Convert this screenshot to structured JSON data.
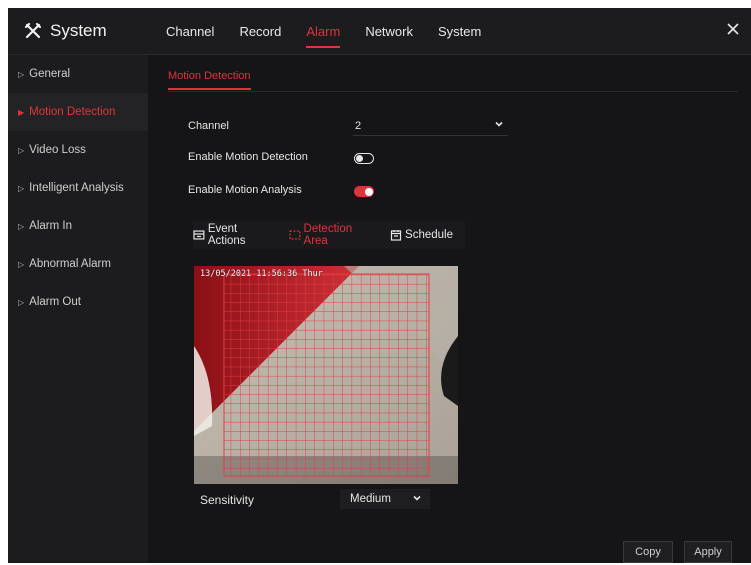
{
  "app": {
    "title": "System"
  },
  "top_tabs": [
    {
      "label": "Channel",
      "active": false
    },
    {
      "label": "Record",
      "active": false
    },
    {
      "label": "Alarm",
      "active": true
    },
    {
      "label": "Network",
      "active": false
    },
    {
      "label": "System",
      "active": false
    }
  ],
  "sidebar": {
    "items": [
      {
        "label": "General",
        "active": false
      },
      {
        "label": "Motion Detection",
        "active": true
      },
      {
        "label": "Video Loss",
        "active": false
      },
      {
        "label": "Intelligent Analysis",
        "active": false
      },
      {
        "label": "Alarm In",
        "active": false
      },
      {
        "label": "Abnormal Alarm",
        "active": false
      },
      {
        "label": "Alarm Out",
        "active": false
      }
    ]
  },
  "page": {
    "subtab": "Motion Detection",
    "channel_label": "Channel",
    "channel_value": "2",
    "enable_motion_label": "Enable Motion Detection",
    "enable_motion_on": false,
    "enable_analysis_label": "Enable Motion Analysis",
    "enable_analysis_on": true,
    "inner_tabs": [
      {
        "label": "Event Actions",
        "icon": "event-actions-icon",
        "active": false
      },
      {
        "label": "Detection Area",
        "icon": "detection-area-icon",
        "active": true
      },
      {
        "label": "Schedule",
        "icon": "calendar-icon",
        "active": false
      }
    ],
    "osd_timestamp": "13/05/2021 11:56:36 Thur",
    "sensitivity_label": "Sensitivity",
    "sensitivity_value": "Medium",
    "copy_label": "Copy",
    "apply_label": "Apply"
  },
  "colors": {
    "accent": "#e0343c",
    "background": "#151517",
    "panel": "#1c1c1e"
  }
}
